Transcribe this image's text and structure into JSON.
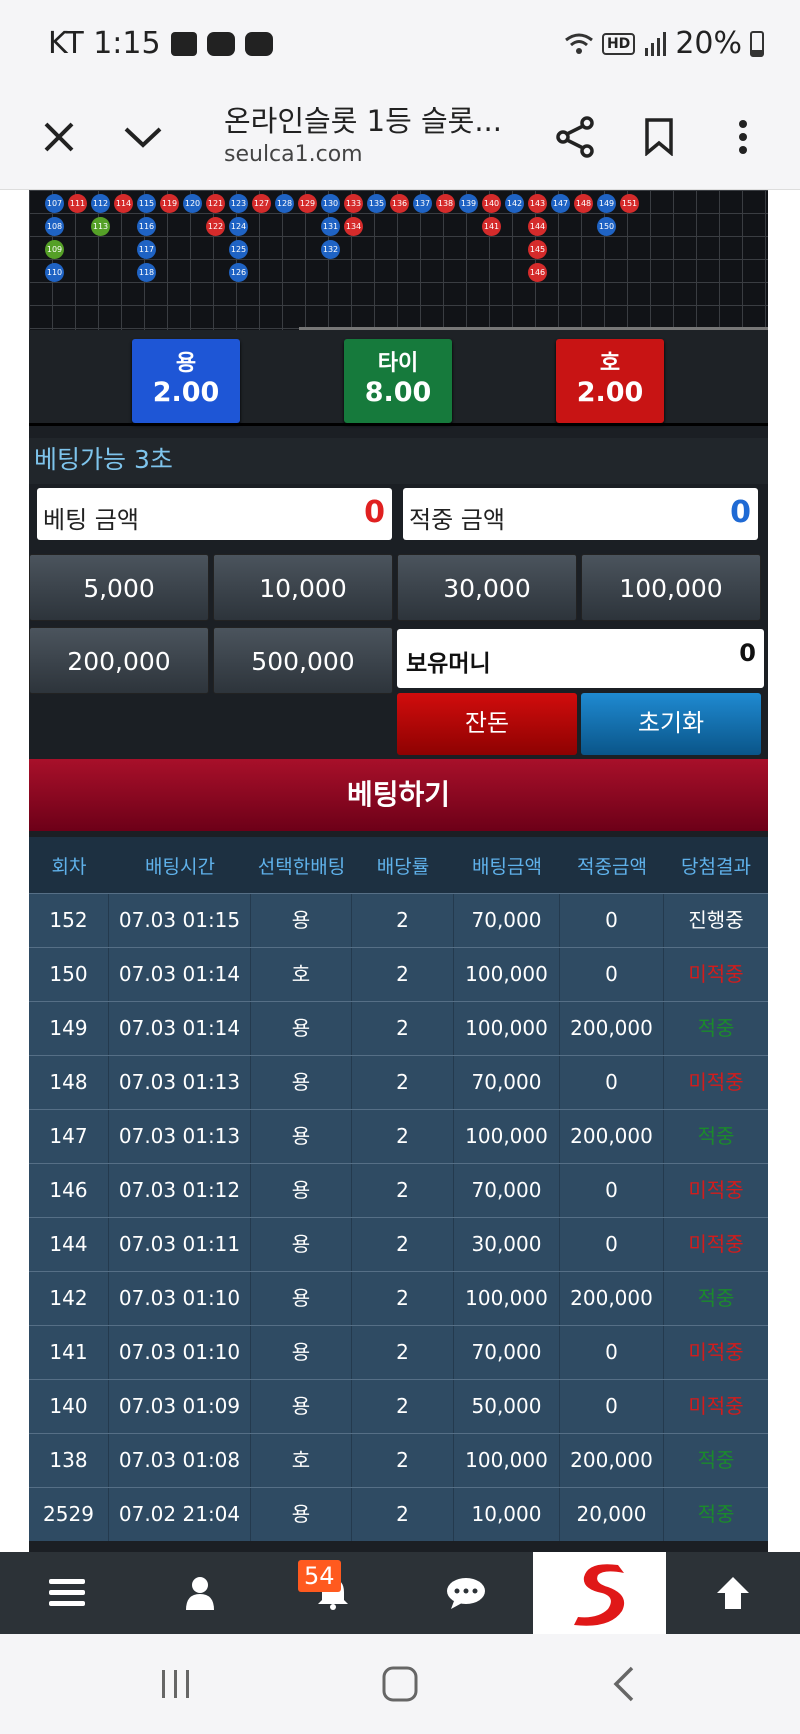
{
  "status_bar": {
    "carrier_time": "KT 1:15",
    "battery": "20%",
    "hd_label": "HD"
  },
  "browser": {
    "title": "온라인슬롯 1등 슬롯...",
    "url": "seulca1.com",
    "icons": [
      "close-icon",
      "chevron-down-icon",
      "share-icon",
      "bookmark-icon",
      "more-icon"
    ]
  },
  "bead_road": [
    {
      "row": 0,
      "items": [
        [
          "107",
          "b"
        ],
        [
          "111",
          "r"
        ],
        [
          "112",
          "b"
        ],
        [
          "114",
          "r"
        ],
        [
          "115",
          "b"
        ],
        [
          "119",
          "r"
        ],
        [
          "120",
          "b"
        ],
        [
          "121",
          "r"
        ],
        [
          "123",
          "b"
        ],
        [
          "127",
          "r"
        ],
        [
          "128",
          "b"
        ],
        [
          "129",
          "r"
        ],
        [
          "130",
          "b"
        ],
        [
          "133",
          "r"
        ],
        [
          "135",
          "b"
        ],
        [
          "136",
          "r"
        ],
        [
          "137",
          "b"
        ],
        [
          "138",
          "r"
        ],
        [
          "139",
          "b"
        ],
        [
          "140",
          "r"
        ],
        [
          "142",
          "b"
        ],
        [
          "143",
          "r"
        ],
        [
          "147",
          "b"
        ],
        [
          "148",
          "r"
        ],
        [
          "149",
          "b"
        ],
        [
          "151",
          "r"
        ]
      ]
    },
    {
      "row": 1,
      "items": [
        [
          "108",
          "b",
          0
        ],
        [
          "113",
          "g",
          2
        ],
        [
          "116",
          "b",
          4
        ],
        [
          "122",
          "r",
          7
        ],
        [
          "124",
          "b",
          8
        ],
        [
          "131",
          "b",
          12
        ],
        [
          "134",
          "r",
          13
        ],
        [
          "141",
          "r",
          19
        ],
        [
          "144",
          "r",
          21
        ],
        [
          "150",
          "b",
          24
        ]
      ]
    },
    {
      "row": 2,
      "items": [
        [
          "109",
          "g",
          0
        ],
        [
          "117",
          "b",
          4
        ],
        [
          "125",
          "b",
          8
        ],
        [
          "132",
          "b",
          12
        ],
        [
          "145",
          "r",
          21
        ]
      ]
    },
    {
      "row": 3,
      "items": [
        [
          "110",
          "b",
          0
        ],
        [
          "118",
          "b",
          4
        ],
        [
          "126",
          "b",
          8
        ],
        [
          "146",
          "r",
          21
        ]
      ]
    }
  ],
  "odds": {
    "dragon": {
      "name": "용",
      "value": "2.00"
    },
    "tie": {
      "name": "타이",
      "value": "8.00"
    },
    "tiger": {
      "name": "호",
      "value": "2.00"
    }
  },
  "bet_status": "베팅가능 3초",
  "bet_amount": {
    "label": "베팅 금액",
    "value": "0"
  },
  "win_amount": {
    "label": "적중 금액",
    "value": "0"
  },
  "chips": [
    "5,000",
    "10,000",
    "30,000",
    "100,000",
    "200,000",
    "500,000"
  ],
  "balance": {
    "label": "보유머니",
    "value": "0"
  },
  "buttons": {
    "reset": "잔돈",
    "init": "초기화",
    "bet": "베팅하기"
  },
  "table": {
    "headers": [
      "회차",
      "배팅시간",
      "선택한배팅",
      "배당률",
      "배팅금액",
      "적중금액",
      "당첨결과"
    ],
    "rows": [
      [
        "152",
        "07.03 01:15",
        "용",
        "2",
        "70,000",
        "0",
        "진행중",
        "live"
      ],
      [
        "150",
        "07.03 01:14",
        "호",
        "2",
        "100,000",
        "0",
        "미적중",
        "miss"
      ],
      [
        "149",
        "07.03 01:14",
        "용",
        "2",
        "100,000",
        "200,000",
        "적중",
        "hit"
      ],
      [
        "148",
        "07.03 01:13",
        "용",
        "2",
        "70,000",
        "0",
        "미적중",
        "miss"
      ],
      [
        "147",
        "07.03 01:13",
        "용",
        "2",
        "100,000",
        "200,000",
        "적중",
        "hit"
      ],
      [
        "146",
        "07.03 01:12",
        "용",
        "2",
        "70,000",
        "0",
        "미적중",
        "miss"
      ],
      [
        "144",
        "07.03 01:11",
        "용",
        "2",
        "30,000",
        "0",
        "미적중",
        "miss"
      ],
      [
        "142",
        "07.03 01:10",
        "용",
        "2",
        "100,000",
        "200,000",
        "적중",
        "hit"
      ],
      [
        "141",
        "07.03 01:10",
        "용",
        "2",
        "70,000",
        "0",
        "미적중",
        "miss"
      ],
      [
        "140",
        "07.03 01:09",
        "용",
        "2",
        "50,000",
        "0",
        "미적중",
        "miss"
      ],
      [
        "138",
        "07.03 01:08",
        "호",
        "2",
        "100,000",
        "200,000",
        "적중",
        "hit"
      ],
      [
        "2529",
        "07.02 21:04",
        "용",
        "2",
        "10,000",
        "20,000",
        "적중",
        "hit"
      ]
    ]
  },
  "bottom_bar": {
    "notification_count": "54",
    "icons": [
      "menu-icon",
      "user-icon",
      "bell-icon",
      "chat-icon",
      "site-logo",
      "arrow-up-icon"
    ]
  }
}
